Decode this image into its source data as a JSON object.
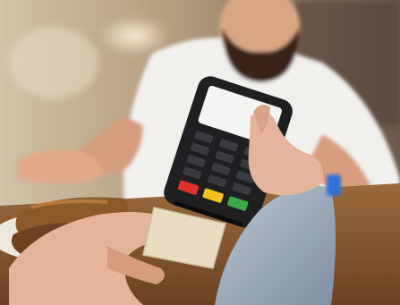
{
  "scene": {
    "subject": "payment-terminal",
    "colors": {
      "background_warm": "#b59a7c",
      "background_dark": "#5a4a3e",
      "counter_wood": "#8a5a32",
      "terminal_body": "#1f1f22",
      "terminal_screen": "#f4f4f2",
      "card": "#e9dcc0",
      "skin": "#e4b59a",
      "sleeve": "#9fb0c2",
      "shirt": "#f2f0ec",
      "beard": "#3a2418",
      "key_red": "#e0322a",
      "key_yellow": "#f2c21a",
      "key_green": "#3aa845",
      "bread": "#8b5a2b"
    }
  }
}
